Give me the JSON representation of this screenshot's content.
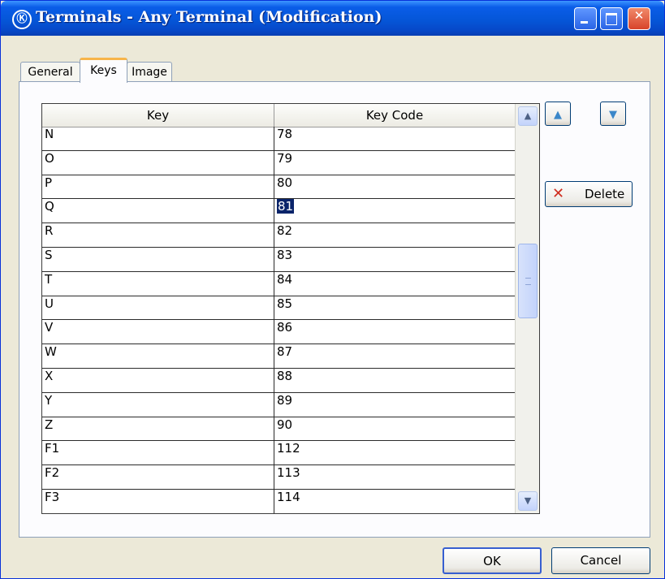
{
  "window": {
    "app_icon": "Ⓚ",
    "title": "Terminals - Any Terminal (Modification)",
    "min_glyph": "",
    "max_glyph": "",
    "close_glyph": "✕"
  },
  "tabs": [
    {
      "label": "General"
    },
    {
      "label": "Keys"
    },
    {
      "label": "Image"
    }
  ],
  "grid": {
    "columns": [
      "Key",
      "Key Code"
    ],
    "rows": [
      {
        "key": "N",
        "code": "78"
      },
      {
        "key": "O",
        "code": "79"
      },
      {
        "key": "P",
        "code": "80"
      },
      {
        "key": "Q",
        "code": "81"
      },
      {
        "key": "R",
        "code": "82"
      },
      {
        "key": "S",
        "code": "83"
      },
      {
        "key": "T",
        "code": "84"
      },
      {
        "key": "U",
        "code": "85"
      },
      {
        "key": "V",
        "code": "86"
      },
      {
        "key": "W",
        "code": "87"
      },
      {
        "key": "X",
        "code": "88"
      },
      {
        "key": "Y",
        "code": "89"
      },
      {
        "key": "Z",
        "code": "90"
      },
      {
        "key": "F1",
        "code": "112"
      },
      {
        "key": "F2",
        "code": "113"
      },
      {
        "key": "F3",
        "code": "114"
      }
    ],
    "selected_row": 3,
    "scroll_up_glyph": "▲",
    "scroll_down_glyph": "▼"
  },
  "side_buttons": {
    "move_up_glyph": "▲",
    "move_down_glyph": "▼",
    "delete_icon": "✕",
    "delete_label": "Delete"
  },
  "footer": {
    "ok_label": "OK",
    "cancel_label": "Cancel"
  },
  "colors": {
    "title_bar": "#0556d8",
    "selection": "#0a246a",
    "delete_icon": "#cf2d1f",
    "active_tab_accent": "#f7b54a"
  }
}
